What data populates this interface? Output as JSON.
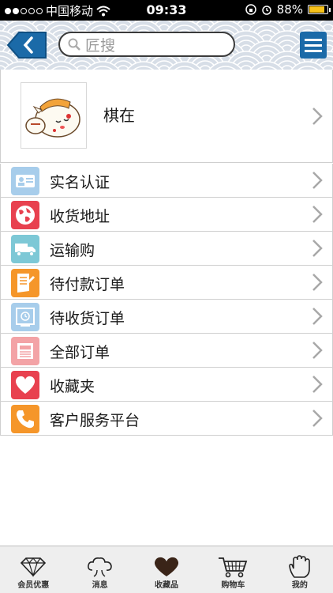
{
  "status_bar": {
    "carrier": "中国移动",
    "time": "09:33",
    "battery": "88%",
    "battery_level": 0.88
  },
  "header": {
    "search_placeholder": "匠搜"
  },
  "profile": {
    "name": "棋在"
  },
  "menu": [
    {
      "label": "实名认证",
      "icon": "id-card-icon",
      "color": "#a7cdeb"
    },
    {
      "label": "收货地址",
      "icon": "globe-icon",
      "color": "#e8414f"
    },
    {
      "label": "运输购",
      "icon": "truck-icon",
      "color": "#7dc8d6"
    },
    {
      "label": "待付款订单",
      "icon": "bill-icon",
      "color": "#f5962a"
    },
    {
      "label": "待收货订单",
      "icon": "clock-screen-icon",
      "color": "#a7cdeb"
    },
    {
      "label": "全部订单",
      "icon": "document-icon",
      "color": "#f3a3a6"
    },
    {
      "label": "收藏夹",
      "icon": "heart-icon",
      "color": "#e8414f"
    },
    {
      "label": "客户服务平台",
      "icon": "phone-icon",
      "color": "#f5962a"
    }
  ],
  "tabs": [
    {
      "label": "会员优惠",
      "icon": "diamond-icon"
    },
    {
      "label": "消息",
      "icon": "cloud-icon"
    },
    {
      "label": "收藏品",
      "icon": "heart-icon"
    },
    {
      "label": "购物车",
      "icon": "cart-icon"
    },
    {
      "label": "我的",
      "icon": "hand-icon"
    }
  ]
}
